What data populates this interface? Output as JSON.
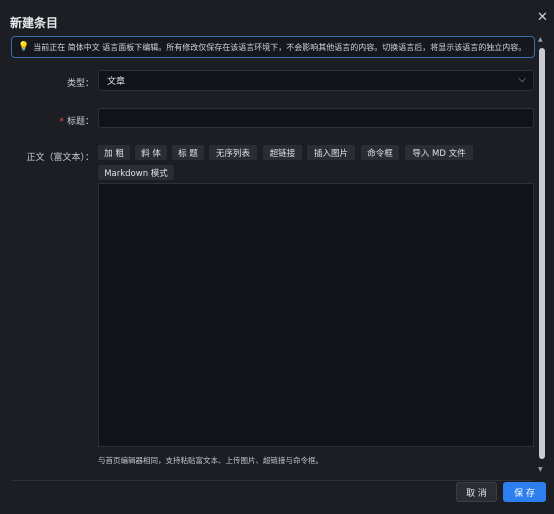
{
  "dialog": {
    "title": "新建条目",
    "close_icon": "close-icon"
  },
  "notice": {
    "icon": "lightbulb-icon",
    "text": "当前正在 简体中文 语言面板下编辑。所有修改仅保存在该语言环境下，不会影响其他语言的内容。切换语言后，将显示该语言的独立内容。"
  },
  "form": {
    "type_label": "类型：",
    "type_value": "文章",
    "title_required_mark": "*",
    "title_label": "标题：",
    "title_value": "",
    "body_label": "正文（富文本）：",
    "toolbar": [
      "加 粗",
      "斜 体",
      "标 题",
      "无序列表",
      "超链接",
      "插入图片",
      "命令框",
      "导入 MD 文件",
      "Markdown 模式"
    ],
    "hint": "与首页编辑器相同，支持粘贴富文本、上传图片、超链接与命令框。"
  },
  "footer": {
    "cancel_label": "取 消",
    "save_label": "保 存"
  },
  "colors": {
    "primary": "#2d7ff0",
    "notice_border": "#3a6ea8",
    "required": "#e0524f"
  }
}
